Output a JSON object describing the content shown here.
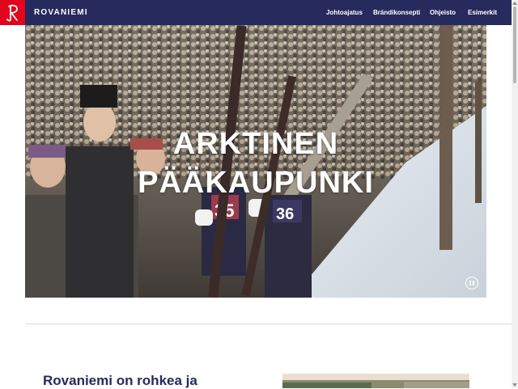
{
  "brand": {
    "name": "ROVANIEMI",
    "logo_letter": "R",
    "colors": {
      "navy": "#262a5c",
      "red": "#e3051b"
    }
  },
  "nav": {
    "items": [
      {
        "label": "Johtoajatus"
      },
      {
        "label": "Brändikonsepti"
      },
      {
        "label": "Ohjeisto"
      },
      {
        "label": "Esimerkit"
      }
    ]
  },
  "hero": {
    "title_line1": "ARKTINEN",
    "title_line2": "PÄÄKAUPUNKI",
    "image": "crowd-ski-jumpers-photo",
    "pause_icon": "pause-icon"
  },
  "intro": {
    "heading": "Rovaniemi on rohkea ja",
    "image": "landscape-photo"
  }
}
